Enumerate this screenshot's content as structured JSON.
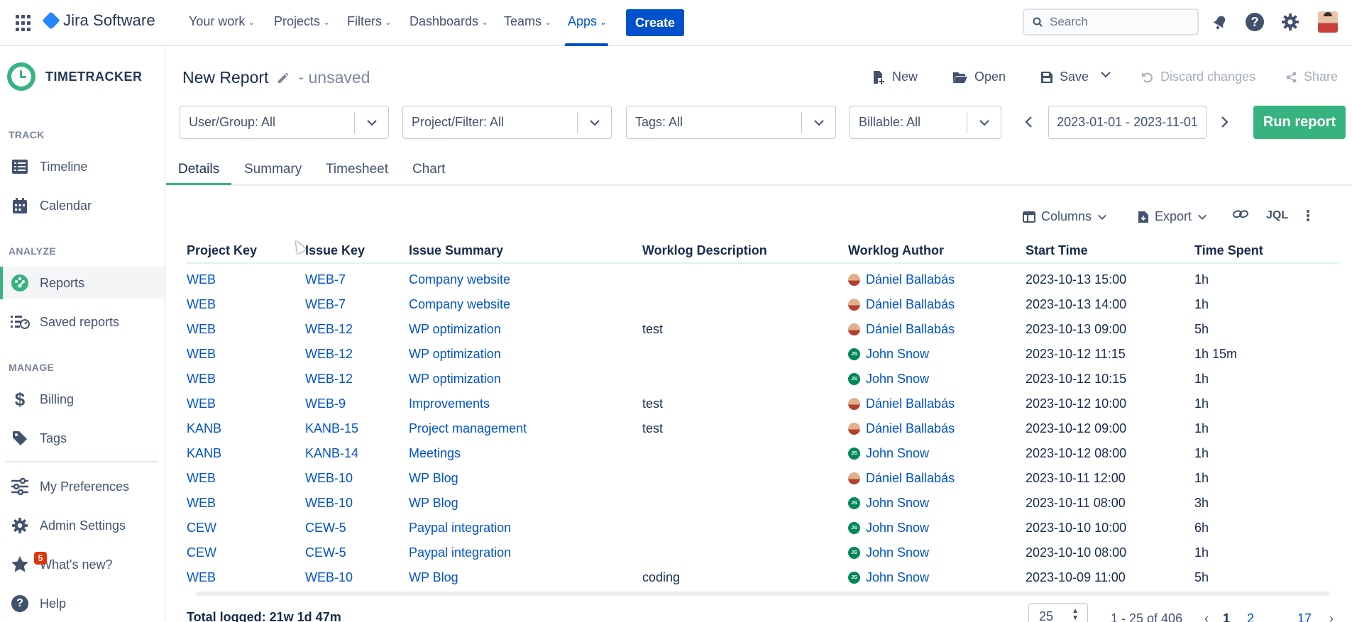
{
  "topnav": {
    "product": "Jira Software",
    "items": [
      {
        "label": "Your work"
      },
      {
        "label": "Projects"
      },
      {
        "label": "Filters"
      },
      {
        "label": "Dashboards"
      },
      {
        "label": "Teams"
      },
      {
        "label": "Apps"
      }
    ],
    "active": "Apps",
    "create_label": "Create",
    "search_placeholder": "Search"
  },
  "sidebar": {
    "app_name": "TIMETRACKER",
    "sections": {
      "track": "TRACK",
      "analyze": "ANALYZE",
      "manage": "MANAGE"
    },
    "items": {
      "timeline": "Timeline",
      "calendar": "Calendar",
      "reports": "Reports",
      "saved_reports": "Saved reports",
      "billing": "Billing",
      "tags": "Tags",
      "preferences": "My Preferences",
      "admin": "Admin Settings",
      "whats_new": "What's new?",
      "help": "Help"
    },
    "whats_new_badge": "5",
    "accent_color": "#36b37e"
  },
  "report": {
    "title": "New Report",
    "status": "- unsaved",
    "actions": {
      "new": "New",
      "open": "Open",
      "save": "Save",
      "discard": "Discard changes",
      "share": "Share"
    }
  },
  "filters": {
    "user_group": "User/Group: All",
    "project_filter": "Project/Filter: All",
    "tags": "Tags: All",
    "billable": "Billable: All",
    "date_range": "2023-01-01 - 2023-11-01",
    "run_label": "Run report"
  },
  "tabs": [
    "Details",
    "Summary",
    "Timesheet",
    "Chart"
  ],
  "active_tab": "Details",
  "toolbar": {
    "columns": "Columns",
    "export": "Export",
    "jql": "JQL"
  },
  "table": {
    "headers": [
      "Project Key",
      "Issue Key",
      "Issue Summary",
      "Worklog Description",
      "Worklog Author",
      "Start Time",
      "Time Spent"
    ],
    "rows": [
      {
        "project": "WEB",
        "issue": "WEB-7",
        "summary": "Company website",
        "desc": "",
        "author": "Dániel Ballabás",
        "avatar": "photo",
        "start": "2023-10-13 15:00",
        "spent": "1h"
      },
      {
        "project": "WEB",
        "issue": "WEB-7",
        "summary": "Company website",
        "desc": "",
        "author": "Dániel Ballabás",
        "avatar": "photo",
        "start": "2023-10-13 14:00",
        "spent": "1h"
      },
      {
        "project": "WEB",
        "issue": "WEB-12",
        "summary": "WP optimization",
        "desc": "test",
        "author": "Dániel Ballabás",
        "avatar": "photo",
        "start": "2023-10-13 09:00",
        "spent": "5h"
      },
      {
        "project": "WEB",
        "issue": "WEB-12",
        "summary": "WP optimization",
        "desc": "",
        "author": "John Snow",
        "avatar": "JS",
        "start": "2023-10-12 11:15",
        "spent": "1h 15m"
      },
      {
        "project": "WEB",
        "issue": "WEB-12",
        "summary": "WP optimization",
        "desc": "",
        "author": "John Snow",
        "avatar": "JS",
        "start": "2023-10-12 10:15",
        "spent": "1h"
      },
      {
        "project": "WEB",
        "issue": "WEB-9",
        "summary": "Improvements",
        "desc": "test",
        "author": "Dániel Ballabás",
        "avatar": "photo",
        "start": "2023-10-12 10:00",
        "spent": "1h"
      },
      {
        "project": "KANB",
        "issue": "KANB-15",
        "summary": "Project management",
        "desc": "test",
        "author": "Dániel Ballabás",
        "avatar": "photo",
        "start": "2023-10-12 09:00",
        "spent": "1h"
      },
      {
        "project": "KANB",
        "issue": "KANB-14",
        "summary": "Meetings",
        "desc": "",
        "author": "John Snow",
        "avatar": "JS",
        "start": "2023-10-12 08:00",
        "spent": "1h"
      },
      {
        "project": "WEB",
        "issue": "WEB-10",
        "summary": "WP Blog",
        "desc": "",
        "author": "Dániel Ballabás",
        "avatar": "photo",
        "start": "2023-10-11 12:00",
        "spent": "1h"
      },
      {
        "project": "WEB",
        "issue": "WEB-10",
        "summary": "WP Blog",
        "desc": "",
        "author": "John Snow",
        "avatar": "JS",
        "start": "2023-10-11 08:00",
        "spent": "3h"
      },
      {
        "project": "CEW",
        "issue": "CEW-5",
        "summary": "Paypal integration",
        "desc": "",
        "author": "John Snow",
        "avatar": "JS",
        "start": "2023-10-10 10:00",
        "spent": "6h"
      },
      {
        "project": "CEW",
        "issue": "CEW-5",
        "summary": "Paypal integration",
        "desc": "",
        "author": "John Snow",
        "avatar": "JS",
        "start": "2023-10-10 08:00",
        "spent": "1h"
      },
      {
        "project": "WEB",
        "issue": "WEB-10",
        "summary": "WP Blog",
        "desc": "coding",
        "author": "John Snow",
        "avatar": "JS",
        "start": "2023-10-09 11:00",
        "spent": "5h"
      }
    ]
  },
  "footer": {
    "total": "Total logged: 21w 1d 47m",
    "page_size": "25",
    "range": "1 - 25 of 406",
    "current_page": "1",
    "next_page": "2",
    "last_page": "17"
  }
}
